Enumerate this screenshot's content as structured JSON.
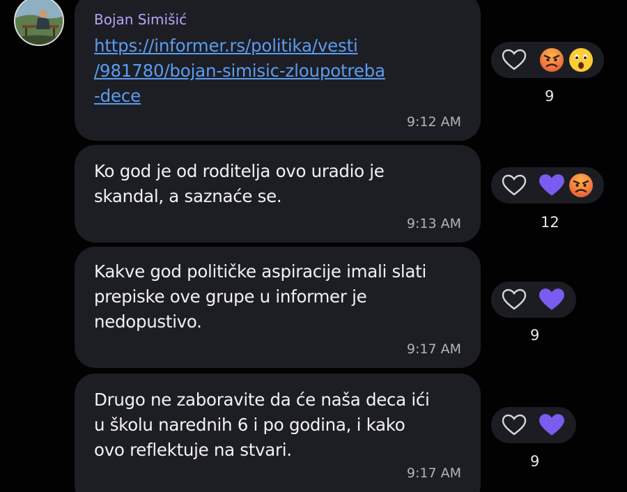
{
  "sender": {
    "name": "Bojan Simišić"
  },
  "messages": [
    {
      "link_lines": [
        "https://informer.rs/politika/vesti",
        "/981780/bojan-simisic-zloupotreba",
        "-dece"
      ],
      "time": "9:12 AM",
      "reactions": [
        "angry",
        "surprised"
      ],
      "count": "9"
    },
    {
      "text_lines": [
        "Ko god je od roditelja ovo uradio je",
        "skandal, a saznaće se."
      ],
      "time": "9:13 AM",
      "reactions": [
        "purple-heart",
        "angry"
      ],
      "count": "12"
    },
    {
      "text_lines": [
        "Kakve god političke aspiracije imali slati",
        "prepiske ove grupe u informer je",
        "nedopustivo."
      ],
      "time": "9:17 AM",
      "reactions": [
        "purple-heart"
      ],
      "count": "9"
    },
    {
      "text_lines": [
        "Drugo ne zaboravite da će naša deca ići",
        "u školu narednih 6 i po godina, i kako",
        "ovo reflektuje na stvari."
      ],
      "time": "9:17 AM",
      "reactions": [
        "purple-heart"
      ],
      "count": "9"
    }
  ],
  "colors": {
    "background": "#020202",
    "bubble": "#1d1e24",
    "sender_name": "#b8a4f5",
    "link": "#5b9cf0",
    "reaction_heart": "#7b5cf0"
  }
}
